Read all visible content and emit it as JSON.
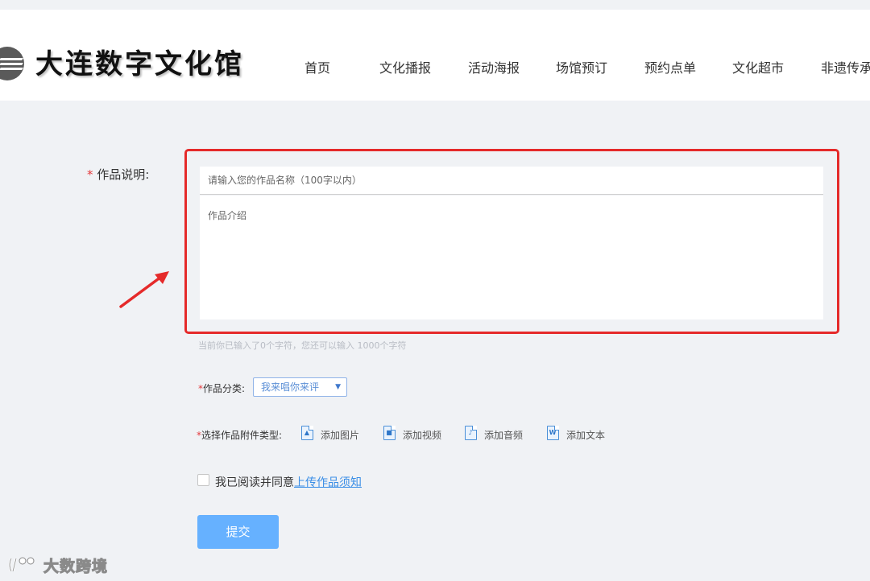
{
  "header": {
    "logo_text": "大连数字文化馆",
    "nav": [
      "首页",
      "文化播报",
      "活动海报",
      "场馆预订",
      "预约点单",
      "文化超市",
      "非遗传承"
    ]
  },
  "form": {
    "required_mark": "*",
    "description_label": "作品说明:",
    "title_placeholder": "请输入您的作品名称（100字以内）",
    "intro_placeholder": "作品介绍",
    "char_count_text": "当前你已输入了0个字符，您还可以输入 1000个字符",
    "category_label": "作品分类:",
    "category_selected": "我来唱你来评",
    "attach_label": "选择作品附件类型:",
    "attachments": [
      {
        "label": "添加图片",
        "icon": "image-file-icon"
      },
      {
        "label": "添加视频",
        "icon": "video-file-icon"
      },
      {
        "label": "添加音频",
        "icon": "audio-file-icon"
      },
      {
        "label": "添加文本",
        "icon": "word-file-icon"
      }
    ],
    "agree_text": "我已阅读并同意",
    "agree_link": "上传作品须知",
    "submit_label": "提交"
  },
  "annotation": {
    "highlight_color": "#e52a2a"
  },
  "watermark": {
    "text": "大数跨境"
  },
  "colors": {
    "accent": "#66b1ff",
    "link": "#3a8ee6"
  }
}
